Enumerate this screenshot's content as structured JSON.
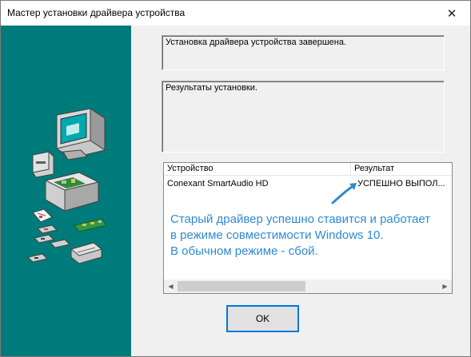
{
  "window": {
    "title": "Мастер установки драйвера устройства",
    "close_glyph": "✕"
  },
  "status_box": {
    "text": "Установка драйвера устройства завершена."
  },
  "results_box": {
    "text": "Результаты установки."
  },
  "results_list": {
    "columns": [
      "Устройство",
      "Результат"
    ],
    "rows": [
      {
        "device": "Conexant SmartAudio HD",
        "result": "УСПЕШНО ВЫПОЛ..."
      }
    ]
  },
  "annotation": {
    "lines": [
      "Старый драйвер успешно ставится и работает",
      "в режиме совместимости Windows 10.",
      "В обычном режиме - сбой."
    ],
    "color": "#2f8ad0"
  },
  "ok_button": {
    "label": "OK"
  },
  "colors": {
    "sidebar": "#007b7b",
    "dialog_bg": "#f0f0f0",
    "focus_border": "#0078d7"
  },
  "icons": {
    "close": "close-icon",
    "illustration": "computer-hardware-illustration",
    "scroll_left": "scroll-left-arrow-icon",
    "scroll_right": "scroll-right-arrow-icon",
    "annotation_arrow": "annotation-arrow-icon"
  }
}
